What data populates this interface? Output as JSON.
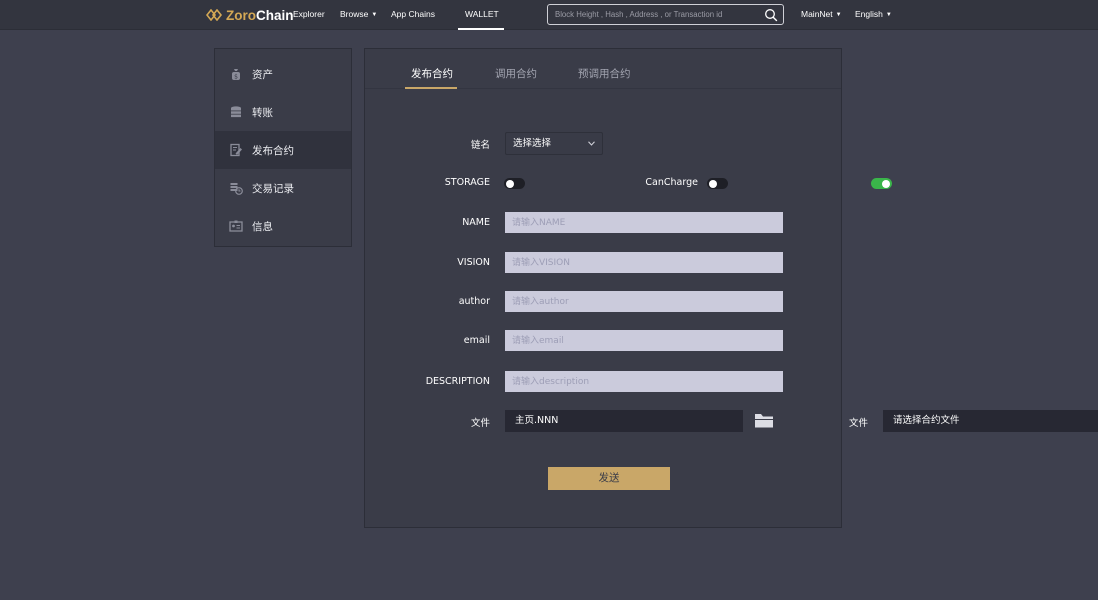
{
  "header": {
    "logo": {
      "part1": "Zoro",
      "part2": "Chain"
    },
    "nav": {
      "explorer": "Explorer",
      "browse": "Browse",
      "app_chains": "App Chains",
      "wallet": "WALLET"
    },
    "search_placeholder": "Block Height , Hash , Address , or Transaction id",
    "network": "MainNet",
    "language": "English",
    "colors": {
      "accent": "#d4a855",
      "background": "#33353f"
    }
  },
  "sidebar": {
    "items": [
      {
        "label": "资产",
        "icon": "money-bag-icon"
      },
      {
        "label": "转账",
        "icon": "coins-stack-icon"
      },
      {
        "label": "发布合约",
        "icon": "edit-document-icon",
        "active": true
      },
      {
        "label": "交易记录",
        "icon": "coin-history-icon"
      },
      {
        "label": "信息",
        "icon": "id-card-icon"
      }
    ]
  },
  "tabs": [
    {
      "label": "发布合约",
      "active": true
    },
    {
      "label": "调用合约"
    },
    {
      "label": "预调用合约"
    }
  ],
  "form": {
    "chain": {
      "label": "链名",
      "value": "选择选择"
    },
    "storage": {
      "label": "STORAGE",
      "on": false
    },
    "can_charge": {
      "label": "CanCharge",
      "on": false
    },
    "extra_toggle": {
      "on": true
    },
    "name": {
      "label": "NAME",
      "placeholder": "请输入NAME"
    },
    "vision": {
      "label": "VISION",
      "placeholder": "请输入VISION"
    },
    "author": {
      "label": "author",
      "placeholder": "请输入author"
    },
    "email": {
      "label": "email",
      "placeholder": "请输入email"
    },
    "description": {
      "label": "DESCRIPTION",
      "placeholder": "请输入description"
    },
    "file": {
      "label": "文件",
      "value": "主页.NNN"
    },
    "file2": {
      "label": "文件",
      "value": "请选择合约文件"
    },
    "submit_label": "发送",
    "colors": {
      "button": "#c9a768",
      "toggle_on": "#3ab54a",
      "input_bg": "#cbcbdc"
    }
  }
}
